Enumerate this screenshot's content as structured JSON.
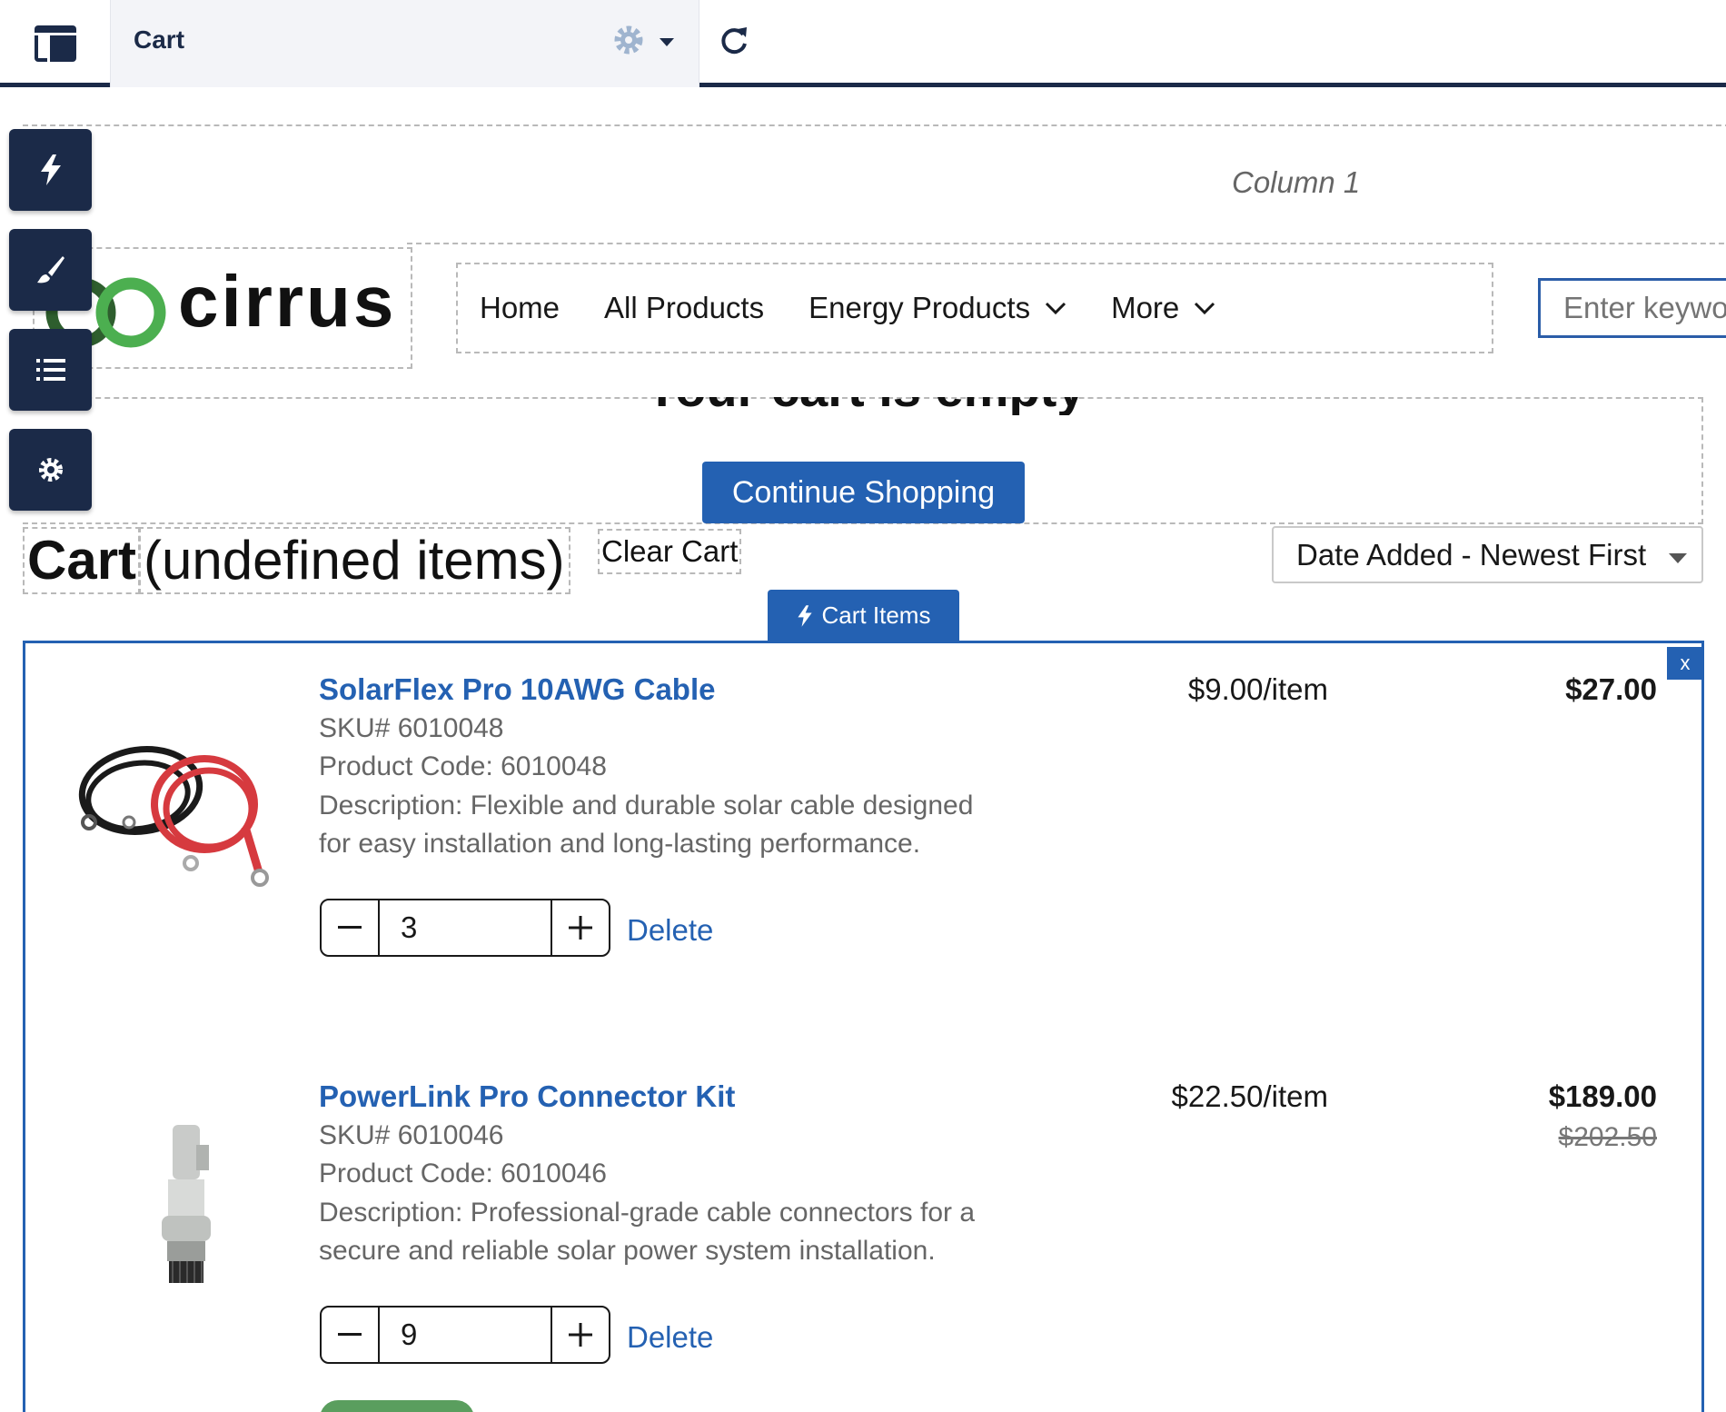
{
  "builder": {
    "page_title": "Cart",
    "menu_icon": "panel-layout-icon",
    "settings_icon": "gear-icon",
    "refresh_icon": "refresh-icon",
    "tools": [
      "lightning-icon",
      "paint-brush-icon",
      "list-icon",
      "settings-gear-icon"
    ]
  },
  "canvas": {
    "column_label": "Column 1"
  },
  "header": {
    "logo_text": "cirrus",
    "nav": [
      {
        "label": "Home",
        "has_menu": false
      },
      {
        "label": "All Products",
        "has_menu": false
      },
      {
        "label": "Energy Products",
        "has_menu": true
      },
      {
        "label": "More",
        "has_menu": true
      }
    ],
    "search_placeholder": "Enter keywo"
  },
  "empty_cart": {
    "message": "Your cart is empty",
    "continue_label": "Continue Shopping"
  },
  "cart": {
    "title": "Cart",
    "count_text": "(undefined items)",
    "clear_label": "Clear Cart",
    "sort_value": "Date Added - Newest First",
    "component_label": "Cart Items",
    "close_label": "x",
    "items": [
      {
        "name": "SolarFlex Pro 10AWG Cable",
        "sku": "SKU# 6010048",
        "product_code": "Product Code: 6010048",
        "description": "Description: Flexible and durable solar cable designed for easy installation and long-lasting performance.",
        "unit_price": "$9.00/item",
        "total": "$27.00",
        "original_total": "",
        "quantity": "3",
        "delete_label": "Delete"
      },
      {
        "name": "PowerLink Pro Connector Kit",
        "sku": "SKU# 6010046",
        "product_code": "Product Code: 6010046",
        "description": "Description: Professional-grade cable connectors for a secure and reliable solar power system installation.",
        "unit_price": "$22.50/item",
        "total": "$189.00",
        "original_total": "$202.50",
        "quantity": "9",
        "delete_label": "Delete"
      }
    ]
  },
  "colors": {
    "builder_navy": "#1b2a48",
    "brand_blue": "#2461b2",
    "logo_green": "#4caf50",
    "logo_dark_green": "#2e5e2e"
  }
}
